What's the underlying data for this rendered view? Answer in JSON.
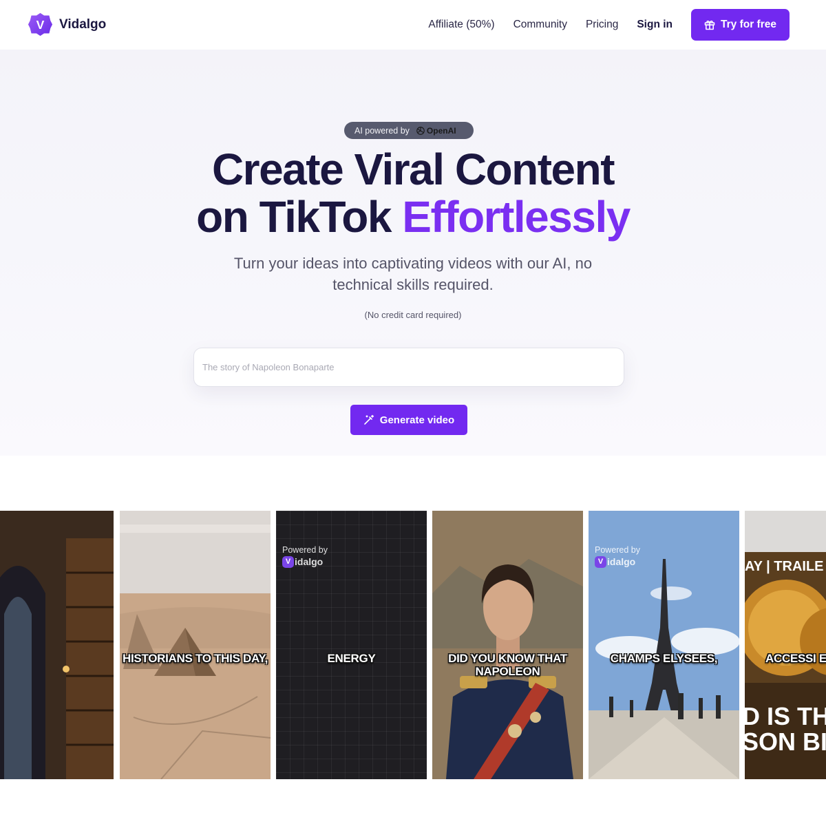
{
  "brand": {
    "name": "Vidalgo",
    "logo_letter": "V",
    "color": "#7229f0"
  },
  "nav": {
    "links": [
      "Affiliate (50%)",
      "Community",
      "Pricing"
    ],
    "signin": "Sign in",
    "cta": "Try for free"
  },
  "hero": {
    "badge_text": "AI powered by",
    "badge_brand": "OpenAI",
    "title_line1": "Create Viral Content",
    "title_line2_plain": "on TikTok ",
    "title_line2_accent": "Effortlessly",
    "subtitle": "Turn your ideas into captivating videos with our AI, no technical skills required.",
    "note": "(No credit card required)",
    "input_placeholder": "The story of Napoleon Bonaparte",
    "input_value": "",
    "generate_label": "Generate video",
    "accent_color": "#7a2ff1"
  },
  "gallery": {
    "cards": [
      {
        "caption": ""
      },
      {
        "caption": "HISTORIANS TO THIS DAY,"
      },
      {
        "caption": "ENERGY",
        "powered_label": "Powered by",
        "powered_brand": "idalgo"
      },
      {
        "caption": "DID YOU KNOW THAT NAPOLEON"
      },
      {
        "caption": "CHAMPS ELYSEES,",
        "powered_label": "Powered by",
        "powered_brand": "idalgo"
      },
      {
        "caption": "ACCESSI EVERY",
        "top_text": "AY | TRAILE",
        "big_text_1": "D IS TH",
        "big_text_2": "SON BI"
      }
    ]
  }
}
